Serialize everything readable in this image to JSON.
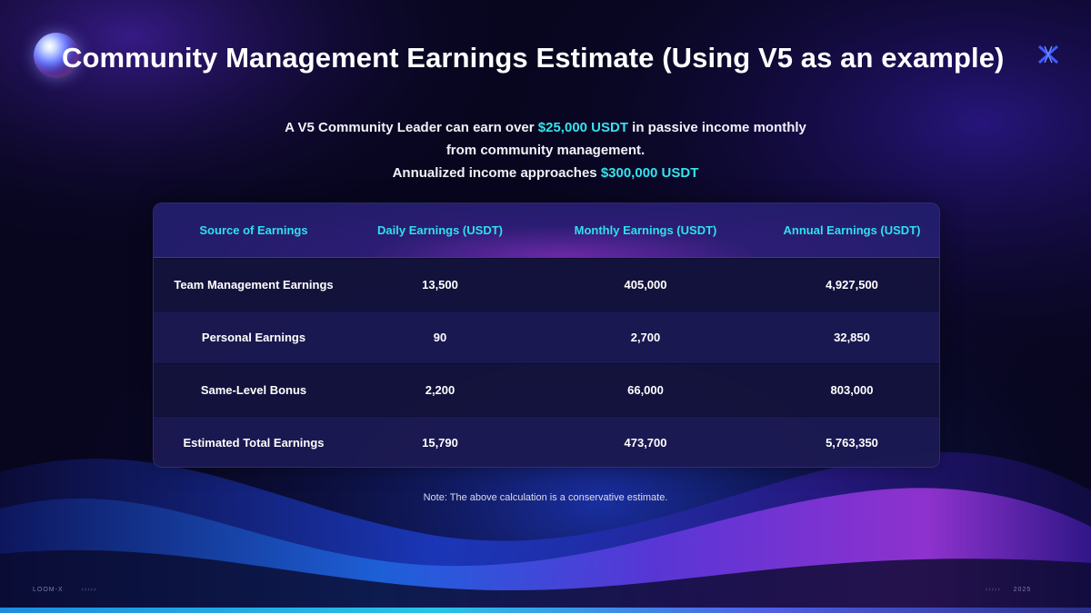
{
  "title": "Community Management Earnings Estimate (Using V5 as an example)",
  "intro": {
    "line1_pre": "A V5 Community Leader can earn over ",
    "line1_highlight": "$25,000 USDT",
    "line1_post": " in passive income monthly",
    "line2": "from community management.",
    "line3_pre": "Annualized income approaches ",
    "line3_highlight": "$300,000 USDT"
  },
  "table": {
    "headers": [
      "Source of Earnings",
      "Daily Earnings (USDT)",
      "Monthly Earnings (USDT)",
      "Annual Earnings (USDT)"
    ],
    "rows": [
      [
        "Team Management Earnings",
        "13,500",
        "405,000",
        "4,927,500"
      ],
      [
        "Personal Earnings",
        "90",
        "2,700",
        "32,850"
      ],
      [
        "Same-Level Bonus",
        "2,200",
        "66,000",
        "803,000"
      ],
      [
        "Estimated Total Earnings",
        "15,790",
        "473,700",
        "5,763,350"
      ]
    ]
  },
  "note": "Note: The above calculation is a conservative estimate.",
  "footer": {
    "left_brand": "LOOM-X",
    "left_arrows": "›››››",
    "right_arrows": "›››››",
    "right_year": "2025"
  },
  "icons": {
    "orb": "sphere-orb-icon",
    "logo": "x-logo-icon"
  },
  "colors": {
    "accent": "#35e3ee",
    "background": "#08061f",
    "header_text": "#2fe0ec"
  }
}
